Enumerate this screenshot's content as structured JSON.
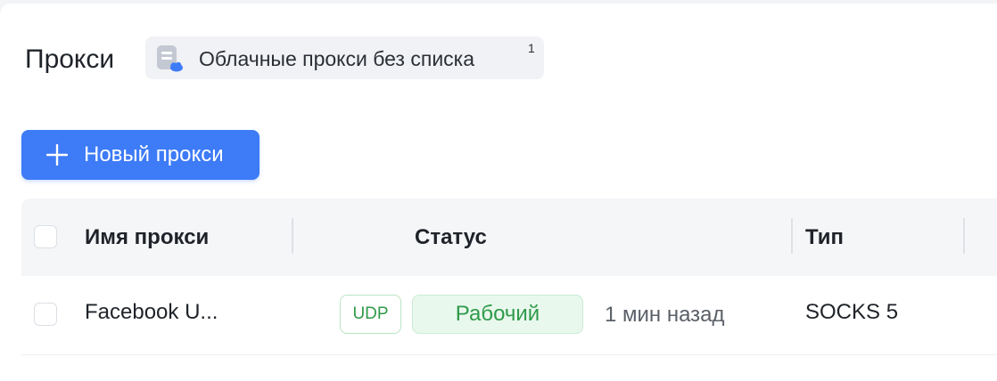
{
  "header": {
    "title": "Прокси",
    "group_chip": {
      "icon": "cloud-list-icon",
      "label": "Облачные прокси без списка",
      "count": "1"
    }
  },
  "toolbar": {
    "new_proxy_label": "Новый прокси",
    "new_proxy_icon": "plus-icon"
  },
  "table": {
    "columns": [
      "Имя прокси",
      "Статус",
      "Тип"
    ],
    "rows": [
      {
        "name": "Facebook U...",
        "protocol_tag": "UDP",
        "status": "Рабочий",
        "checked_ago": "1 мин назад",
        "type": "SOCKS 5"
      }
    ]
  },
  "colors": {
    "primary": "#3d7bf7",
    "status_green": "#2f9a4a",
    "status_bg": "#e9f8ed",
    "header_bg": "#f5f6f8"
  }
}
